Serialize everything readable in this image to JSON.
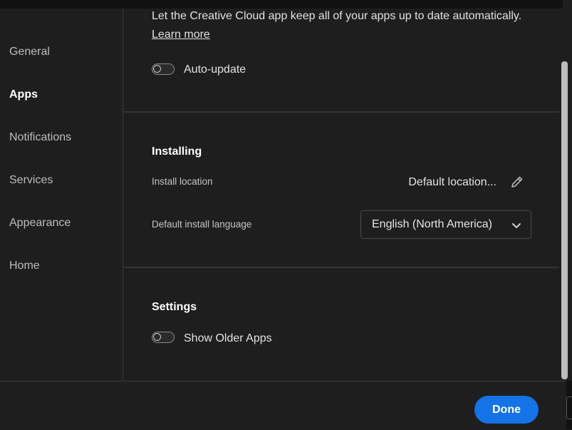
{
  "sidebar": {
    "items": [
      {
        "label": "General",
        "active": false
      },
      {
        "label": "Apps",
        "active": true
      },
      {
        "label": "Notifications",
        "active": false
      },
      {
        "label": "Services",
        "active": false
      },
      {
        "label": "Appearance",
        "active": false
      },
      {
        "label": "Home",
        "active": false
      }
    ]
  },
  "updates": {
    "description": "Let the Creative Cloud app keep all of your apps up to date automatically.",
    "learn_more": "Learn more",
    "auto_update_label": "Auto-update",
    "auto_update_on": false
  },
  "installing": {
    "title": "Installing",
    "location_label": "Install location",
    "location_value": "Default location...",
    "language_label": "Default install language",
    "language_value": "English (North America)"
  },
  "settings": {
    "title": "Settings",
    "show_older_label": "Show Older Apps",
    "show_older_on": false
  },
  "footer": {
    "done_label": "Done"
  },
  "icons": {
    "edit": "pencil-icon",
    "dropdown": "chevron-down-icon"
  },
  "colors": {
    "accent": "#1473e6",
    "background": "#1e1e1e"
  }
}
